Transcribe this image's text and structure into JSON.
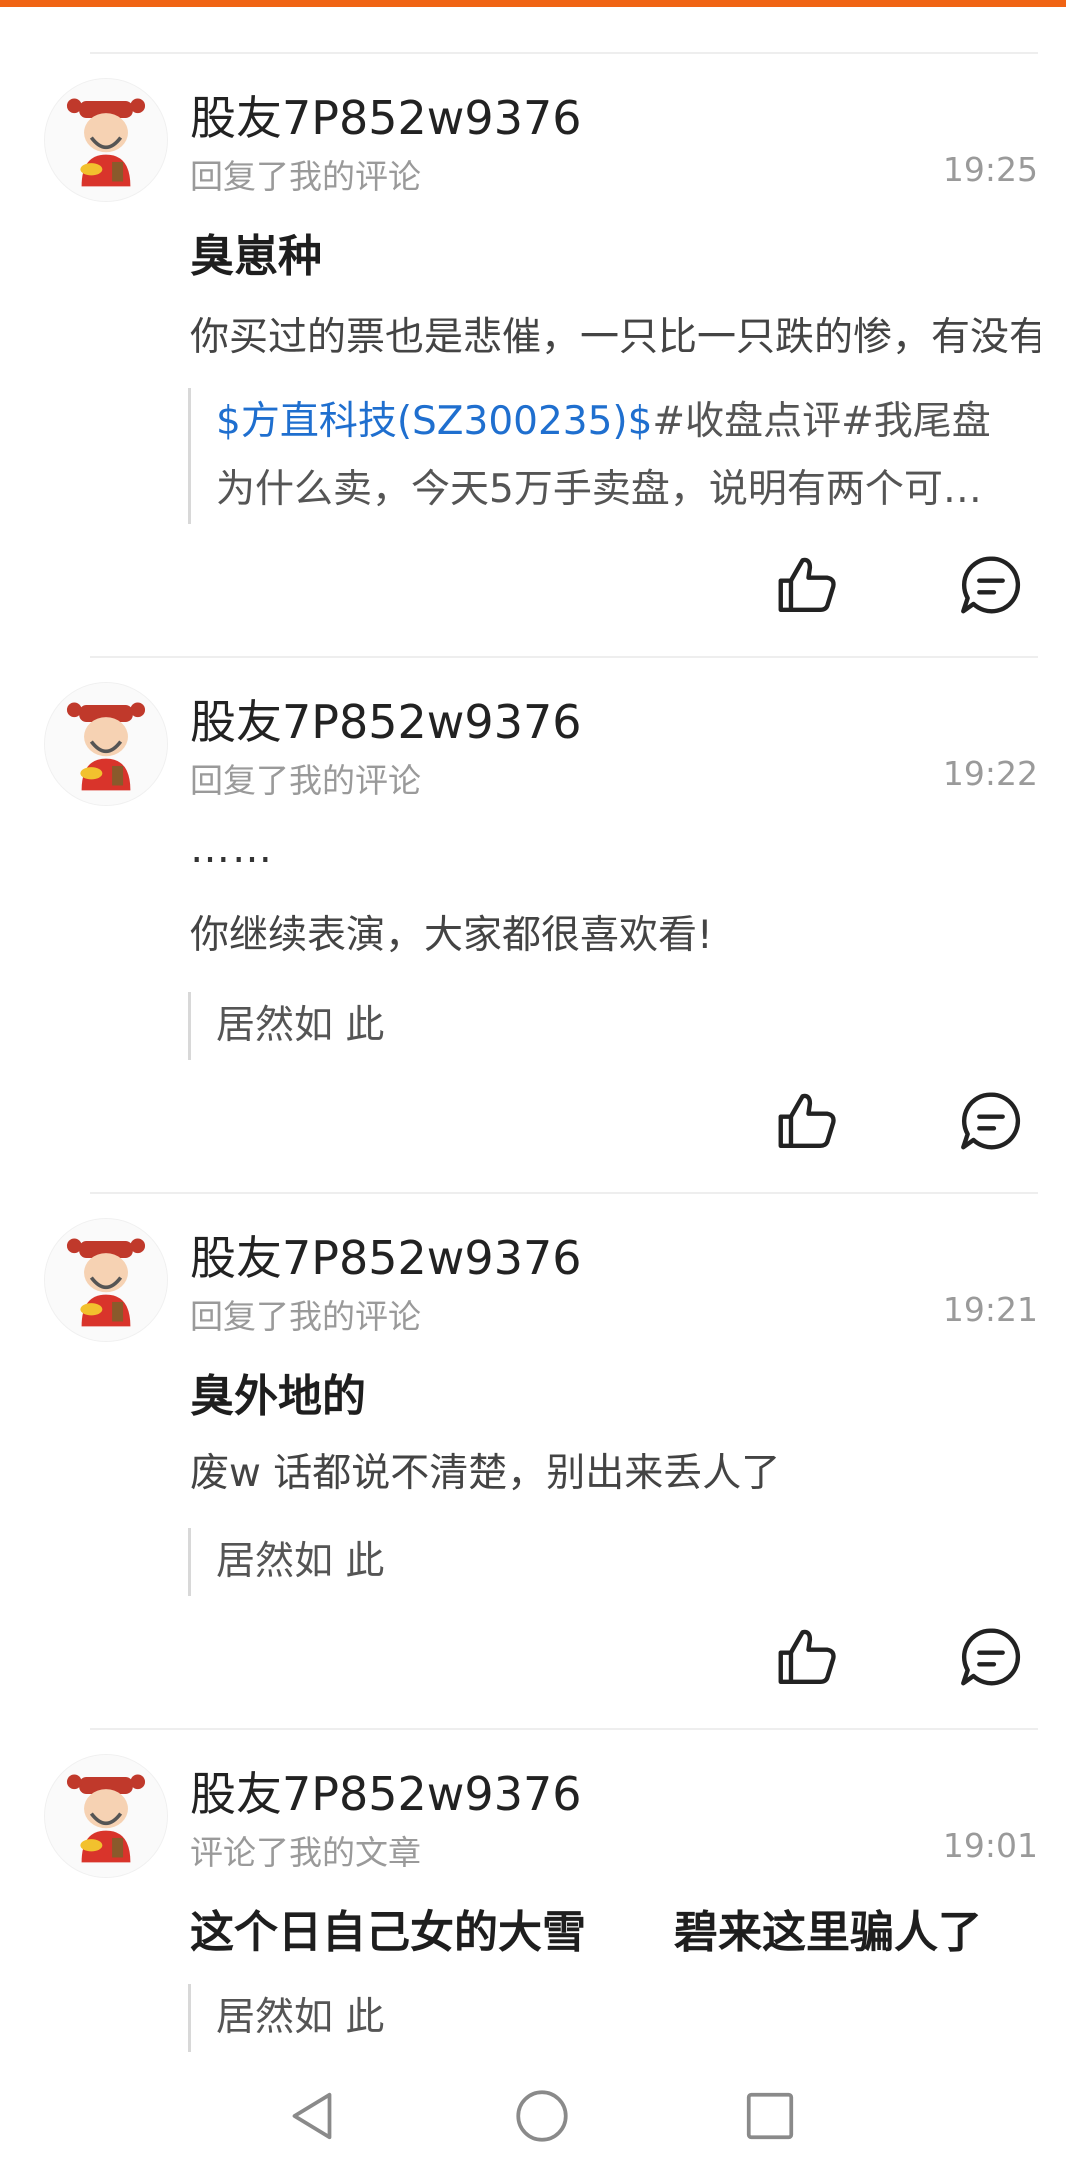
{
  "items": [
    {
      "username": "股友7P852w9376",
      "action": "回复了我的评论",
      "time": "19:25",
      "title": "臭崽种",
      "body": "你买过的票也是悲催，一只比一只跌的惨，有没有",
      "quote_link": "$方直科技(SZ300235)$",
      "quote_rest": "#收盘点评#我尾盘",
      "quote_line2": "为什么卖，今天5万手卖盘，说明有两个可…"
    },
    {
      "username": "股友7P852w9376",
      "action": "回复了我的评论",
      "time": "19:22",
      "title": "……",
      "body": "你继续表演，大家都很喜欢看!",
      "quote": "居然如 此"
    },
    {
      "username": "股友7P852w9376",
      "action": "回复了我的评论",
      "time": "19:21",
      "title": "臭外地的",
      "body": "废w  话都说不清楚，别出来丢人了",
      "quote": "居然如 此"
    },
    {
      "username": "股友7P852w9376",
      "action": "评论了我的文章",
      "time": "19:01",
      "title": "这个日自己女的大雪　　碧来这里骗人了",
      "quote": "居然如 此"
    }
  ],
  "colors": {
    "accent": "#f06414",
    "link": "#1f6fcf",
    "muted": "#9a9a9a"
  },
  "icons": {
    "like": "thumbs-up-icon",
    "reply": "comment-icon",
    "nav_back": "back-triangle-icon",
    "nav_home": "home-circle-icon",
    "nav_recent": "recent-square-icon"
  }
}
